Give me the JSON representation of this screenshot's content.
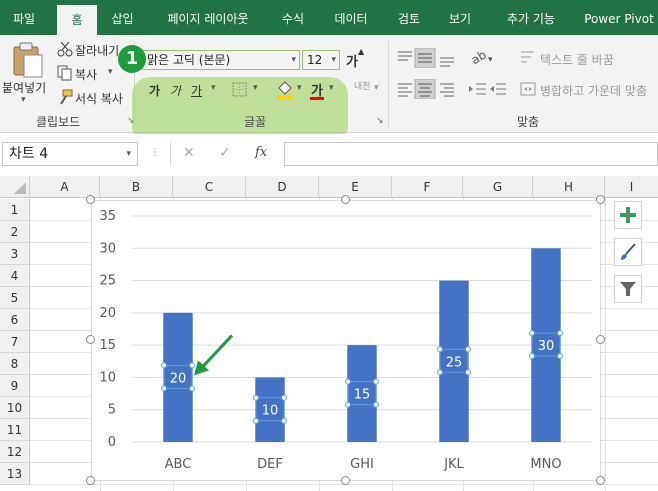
{
  "tabs": [
    {
      "label": "파일"
    },
    {
      "label": "홈"
    },
    {
      "label": "삽입"
    },
    {
      "label": "페이지 레이아웃"
    },
    {
      "label": "수식"
    },
    {
      "label": "데이터"
    },
    {
      "label": "검토"
    },
    {
      "label": "보기"
    },
    {
      "label": "추가 기능"
    },
    {
      "label": "Power Pivot"
    }
  ],
  "active_tab_index": 1,
  "clipboard": {
    "paste": "붙여넣기",
    "cut": "잘라내기",
    "copy": "복사",
    "format_painter": "서식 복사",
    "group_label": "클립보드"
  },
  "font": {
    "font_name": "맑은 고딕 (본문)",
    "font_size": "12",
    "bold": "가",
    "italic": "가",
    "underline": "가",
    "grow": "가",
    "font_color_glyph": "가",
    "phonetic": "내천",
    "group_label": "글꼴",
    "highlight_color": "#92d050"
  },
  "alignment": {
    "wrap_text": "텍스트 줄 바꿈",
    "merge_center": "병합하고 가운데 맞춤",
    "group_label": "맞춤"
  },
  "callout_number": "1",
  "formula_bar": {
    "name_box": "차트 4",
    "cancel": "✕",
    "enter": "✓",
    "function": "fx",
    "formula": ""
  },
  "columns": [
    "A",
    "B",
    "C",
    "D",
    "E",
    "F",
    "G",
    "H",
    "I"
  ],
  "rows": [
    "1",
    "2",
    "3",
    "4",
    "5",
    "6",
    "7",
    "8",
    "9",
    "10",
    "11",
    "12",
    "13"
  ],
  "chart_data": {
    "type": "bar",
    "categories": [
      "ABC",
      "DEF",
      "GHI",
      "JKL",
      "MNO"
    ],
    "values": [
      20,
      10,
      15,
      25,
      30
    ],
    "ylim": [
      0,
      35
    ],
    "yticks": [
      "0",
      "5",
      "10",
      "15",
      "20",
      "25",
      "30",
      "35"
    ],
    "data_labels": [
      "20",
      "10",
      "15",
      "25",
      "30"
    ],
    "bar_color": "#4472c4",
    "grid": true,
    "legend": "none"
  },
  "chart_side_buttons": {
    "add": "plus-icon",
    "style": "brush-icon",
    "filter": "filter-icon"
  },
  "colors": {
    "tab_bar": "#217346",
    "ribbon": "#f3f3f3",
    "arrow": "#1b9e3a",
    "label_handle": "#5ba0e0"
  }
}
